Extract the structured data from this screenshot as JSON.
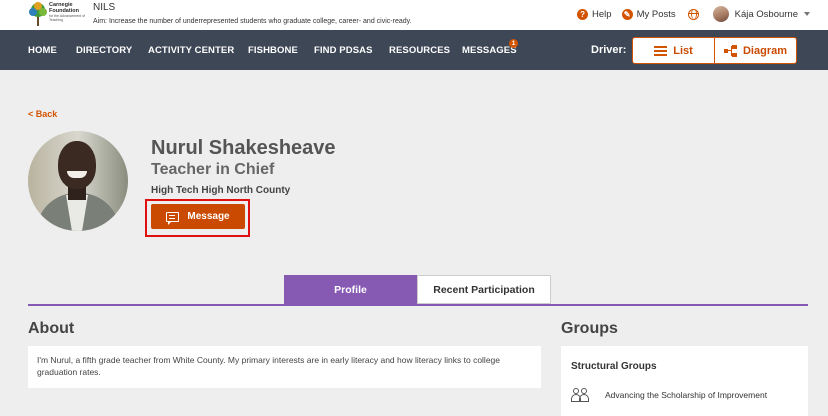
{
  "header": {
    "logo_line1": "Carnegie",
    "logo_line2": "Foundation",
    "logo_sub": "for the Advancement of Teaching",
    "app_name": "NILS",
    "aim": "Aim: Increase the number of underrepresented students who graduate college, career- and civic-ready.",
    "help_label": "Help",
    "my_posts_label": "My Posts",
    "user_name": "Kája Osbourne"
  },
  "nav": {
    "items": [
      "HOME",
      "DIRECTORY",
      "ACTIVITY CENTER",
      "FISHBONE",
      "FIND PDSAS",
      "RESOURCES",
      "MESSAGES"
    ],
    "messages_badge": "1",
    "driver_label": "Driver:",
    "list_label": "List",
    "diagram_label": "Diagram"
  },
  "profile": {
    "back_label": "< Back",
    "name": "Nurul Shakesheave",
    "title": "Teacher in Chief",
    "organization": "High Tech High North County",
    "message_label": "Message"
  },
  "tabs": {
    "profile": "Profile",
    "recent": "Recent Participation"
  },
  "about": {
    "heading": "About",
    "text": "I'm Nurul, a fifth grade teacher from White County. My primary interests are in early literacy and how literacy links to college graduation rates."
  },
  "groups": {
    "heading": "Groups",
    "subheading": "Structural Groups",
    "items": [
      "Advancing the Scholarship of Improvement"
    ]
  },
  "colors": {
    "nav_bg": "#3d4756",
    "accent_orange": "#c94a00",
    "tab_purple": "#8659b3",
    "highlight_red": "#e01010"
  }
}
